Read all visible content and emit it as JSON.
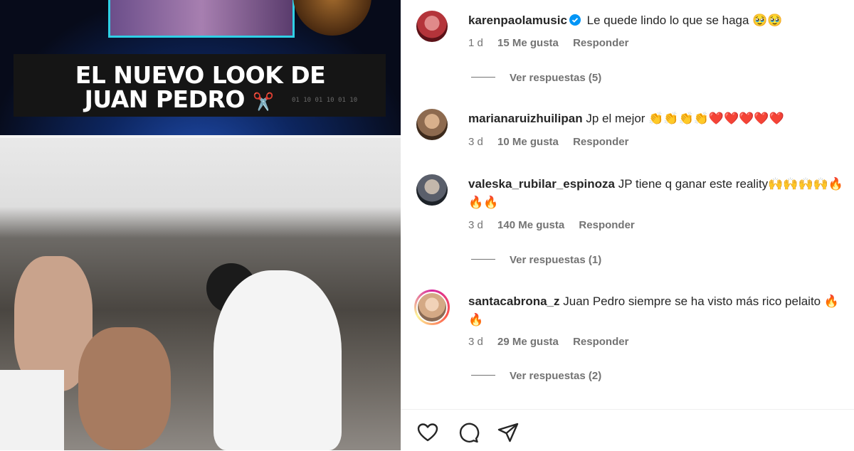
{
  "media": {
    "banner_line1": "EL NUEVO LOOK DE",
    "banner_line2": "JUAN PEDRO",
    "banner_emoji": "✂️",
    "binary_text": "01 10 01 10 01 10"
  },
  "comments": [
    {
      "username": "karenpaolamusic",
      "verified": true,
      "text": "Le quede lindo lo que se haga 🥹🥹",
      "time": "1 d",
      "likes": "15 Me gusta",
      "reply_label": "Responder",
      "view_replies": "Ver respuestas (5)"
    },
    {
      "username": "marianaruizhuilipan",
      "text": "Jp el mejor 👏👏👏👏❤️❤️❤️❤️❤️",
      "time": "3 d",
      "likes": "10 Me gusta",
      "reply_label": "Responder"
    },
    {
      "username": "valeska_rubilar_espinoza",
      "text": "JP tiene q ganar este reality🙌🙌🙌🙌🔥🔥🔥",
      "time": "3 d",
      "likes": "140 Me gusta",
      "reply_label": "Responder",
      "view_replies": "Ver respuestas (1)"
    },
    {
      "username": "santacabrona_z",
      "text": "Juan Pedro siempre se ha visto más rico pelaito 🔥🔥",
      "time": "3 d",
      "likes": "29 Me gusta",
      "reply_label": "Responder",
      "view_replies": "Ver respuestas (2)"
    }
  ],
  "actions": {
    "icons": [
      "heart-icon",
      "comment-icon",
      "share-icon"
    ]
  }
}
